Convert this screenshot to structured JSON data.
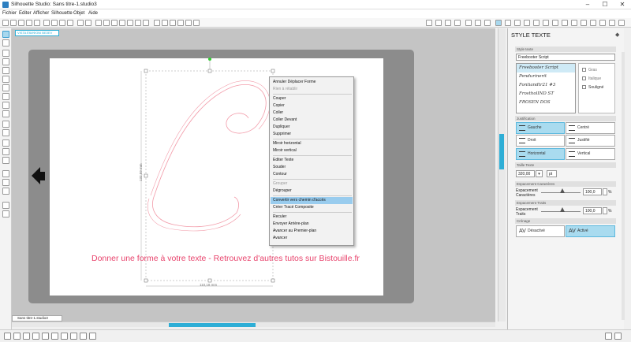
{
  "window": {
    "title": "Silhouette Studio: Sans titre-1.studio3"
  },
  "menu_bar": [
    "Fichier",
    "Editer",
    "Afficher",
    "Silhouette",
    "Objet",
    "Aide"
  ],
  "document": {
    "label": "VISTA ЁКИФОNI ВЕЗEV",
    "tab_name": "Sans titre-1.studio3"
  },
  "canvas": {
    "caption": "Donner une forme à votre texte - Retrouvez d'autres tutos sur Bistouille.fr",
    "width_dim": "110,18 mm",
    "height_dim": "132,59 mm"
  },
  "context_menu": {
    "items": [
      {
        "label": "Annuler Déplacer Forme",
        "disabled": false
      },
      {
        "label": "Rien à rétablir",
        "disabled": true
      },
      {
        "label": "Couper",
        "disabled": false
      },
      {
        "label": "Copier",
        "disabled": false
      },
      {
        "label": "Coller",
        "disabled": false
      },
      {
        "label": "Coller Devant",
        "disabled": false
      },
      {
        "label": "Dupliquer",
        "disabled": false
      },
      {
        "label": "Supprimer",
        "disabled": false
      },
      {
        "label": "Miroir horizontal",
        "disabled": false
      },
      {
        "label": "Miroir vertical",
        "disabled": false
      },
      {
        "label": "Editer Texte",
        "disabled": false
      },
      {
        "label": "Souder",
        "disabled": false
      },
      {
        "label": "Contour",
        "disabled": false
      },
      {
        "label": "Grouper",
        "disabled": true
      },
      {
        "label": "Dégrouper",
        "disabled": false
      },
      {
        "label": "Convertir vers chemin d'accès",
        "disabled": false,
        "highlighted": true
      },
      {
        "label": "Créer Tracé Composite",
        "disabled": false
      },
      {
        "label": "Reculer",
        "disabled": false
      },
      {
        "label": "Envoyer Arrière-plan",
        "disabled": false
      },
      {
        "label": "Avancer au Premier-plan",
        "disabled": false
      },
      {
        "label": "Avancer",
        "disabled": false
      }
    ]
  },
  "panel": {
    "title": "STYLE TEXTE",
    "font_section": "Style texte",
    "font_name": "Freebooter Script",
    "fonts": [
      "Freebooter Script",
      "Pendurinerit",
      "Fontiandtr21 #3",
      "FrostholIND ST",
      "FROSEN DOS"
    ],
    "style_options": [
      "Gras",
      "Italique",
      "Souligné"
    ],
    "justification": {
      "label": "Justification",
      "left": "Gauche",
      "center": "Centré",
      "right": "Droit",
      "justify": "Justifié"
    },
    "orientation": {
      "horizontal": "Horizontal",
      "vertical": "Vertical"
    },
    "text_size": {
      "label": "Taille Texte",
      "value": "320,00",
      "unit": "pt"
    },
    "char_spacing": {
      "section": "Espacement Caractères",
      "label1": "Espacement",
      "label2": "Caractères",
      "value": "100,0",
      "unit": "%"
    },
    "line_spacing": {
      "section": "Espacement Traits",
      "label1": "Espacement",
      "label2": "Traits",
      "value": "100,0",
      "unit": "%"
    },
    "kerning": {
      "section": "Crénage",
      "off": "Désactivé",
      "on": "Activé"
    }
  },
  "accent_color": "#2eaed6",
  "caption_color": "#e8436c"
}
